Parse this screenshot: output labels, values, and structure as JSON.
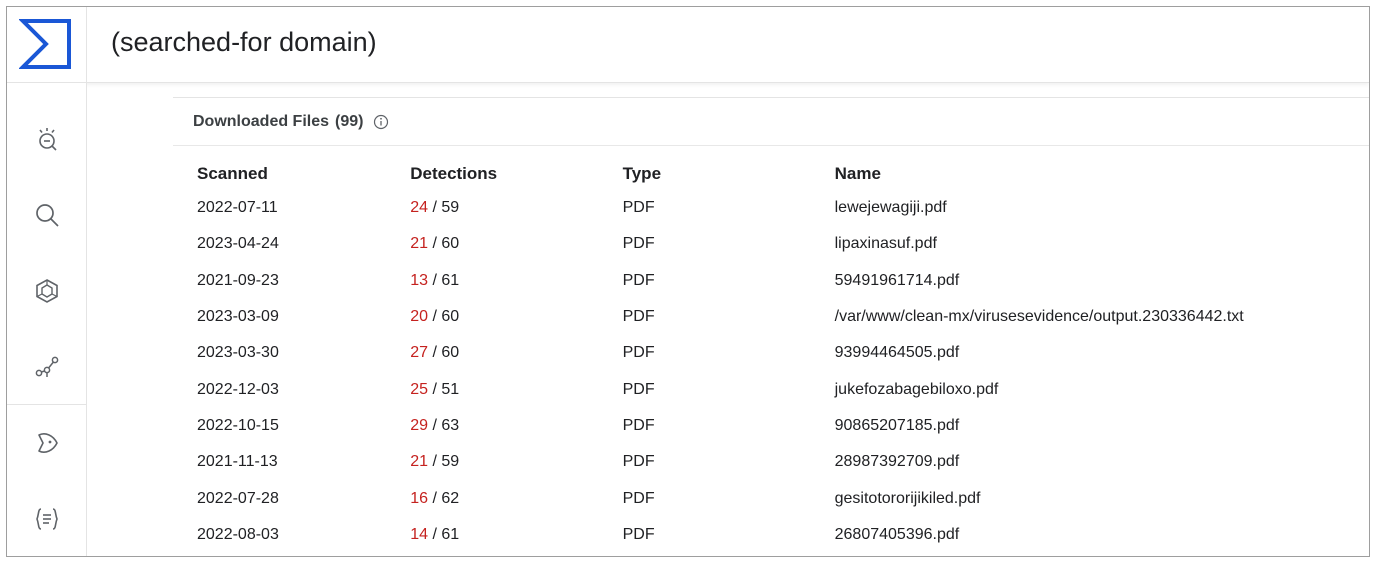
{
  "header": {
    "search_title": "(searched-for domain)"
  },
  "sidebar": {
    "items": [
      {
        "icon": "threat-landscape-icon"
      },
      {
        "icon": "search-icon"
      },
      {
        "icon": "hunting-network-icon"
      },
      {
        "icon": "graph-icon"
      },
      {
        "icon": "collections-icon"
      },
      {
        "icon": "api-json-icon"
      }
    ]
  },
  "panel": {
    "title": "Downloaded Files",
    "count": "(99)"
  },
  "table": {
    "columns": [
      "Scanned",
      "Detections",
      "Type",
      "Name"
    ],
    "rows": [
      {
        "scanned": "2022-07-11",
        "det_pos": "24",
        "det_total": " / 59",
        "type": "PDF",
        "name": "lewejewagiji.pdf"
      },
      {
        "scanned": "2023-04-24",
        "det_pos": "21",
        "det_total": " / 60",
        "type": "PDF",
        "name": "lipaxinasuf.pdf"
      },
      {
        "scanned": "2021-09-23",
        "det_pos": "13",
        "det_total": " / 61",
        "type": "PDF",
        "name": "59491961714.pdf"
      },
      {
        "scanned": "2023-03-09",
        "det_pos": "20",
        "det_total": " / 60",
        "type": "PDF",
        "name": "/var/www/clean-mx/virusesevidence/output.230336442.txt"
      },
      {
        "scanned": "2023-03-30",
        "det_pos": "27",
        "det_total": " / 60",
        "type": "PDF",
        "name": "93994464505.pdf"
      },
      {
        "scanned": "2022-12-03",
        "det_pos": "25",
        "det_total": " / 51",
        "type": "PDF",
        "name": "jukefozabagebiloxo.pdf"
      },
      {
        "scanned": "2022-10-15",
        "det_pos": "29",
        "det_total": " / 63",
        "type": "PDF",
        "name": "90865207185.pdf"
      },
      {
        "scanned": "2021-11-13",
        "det_pos": "21",
        "det_total": " / 59",
        "type": "PDF",
        "name": "28987392709.pdf"
      },
      {
        "scanned": "2022-07-28",
        "det_pos": "16",
        "det_total": " / 62",
        "type": "PDF",
        "name": "gesitotororijikiled.pdf"
      },
      {
        "scanned": "2022-08-03",
        "det_pos": "14",
        "det_total": " / 61",
        "type": "PDF",
        "name": "26807405396.pdf"
      }
    ]
  },
  "colors": {
    "accent": "#1a57d6",
    "detection_positive": "#c5221f"
  }
}
